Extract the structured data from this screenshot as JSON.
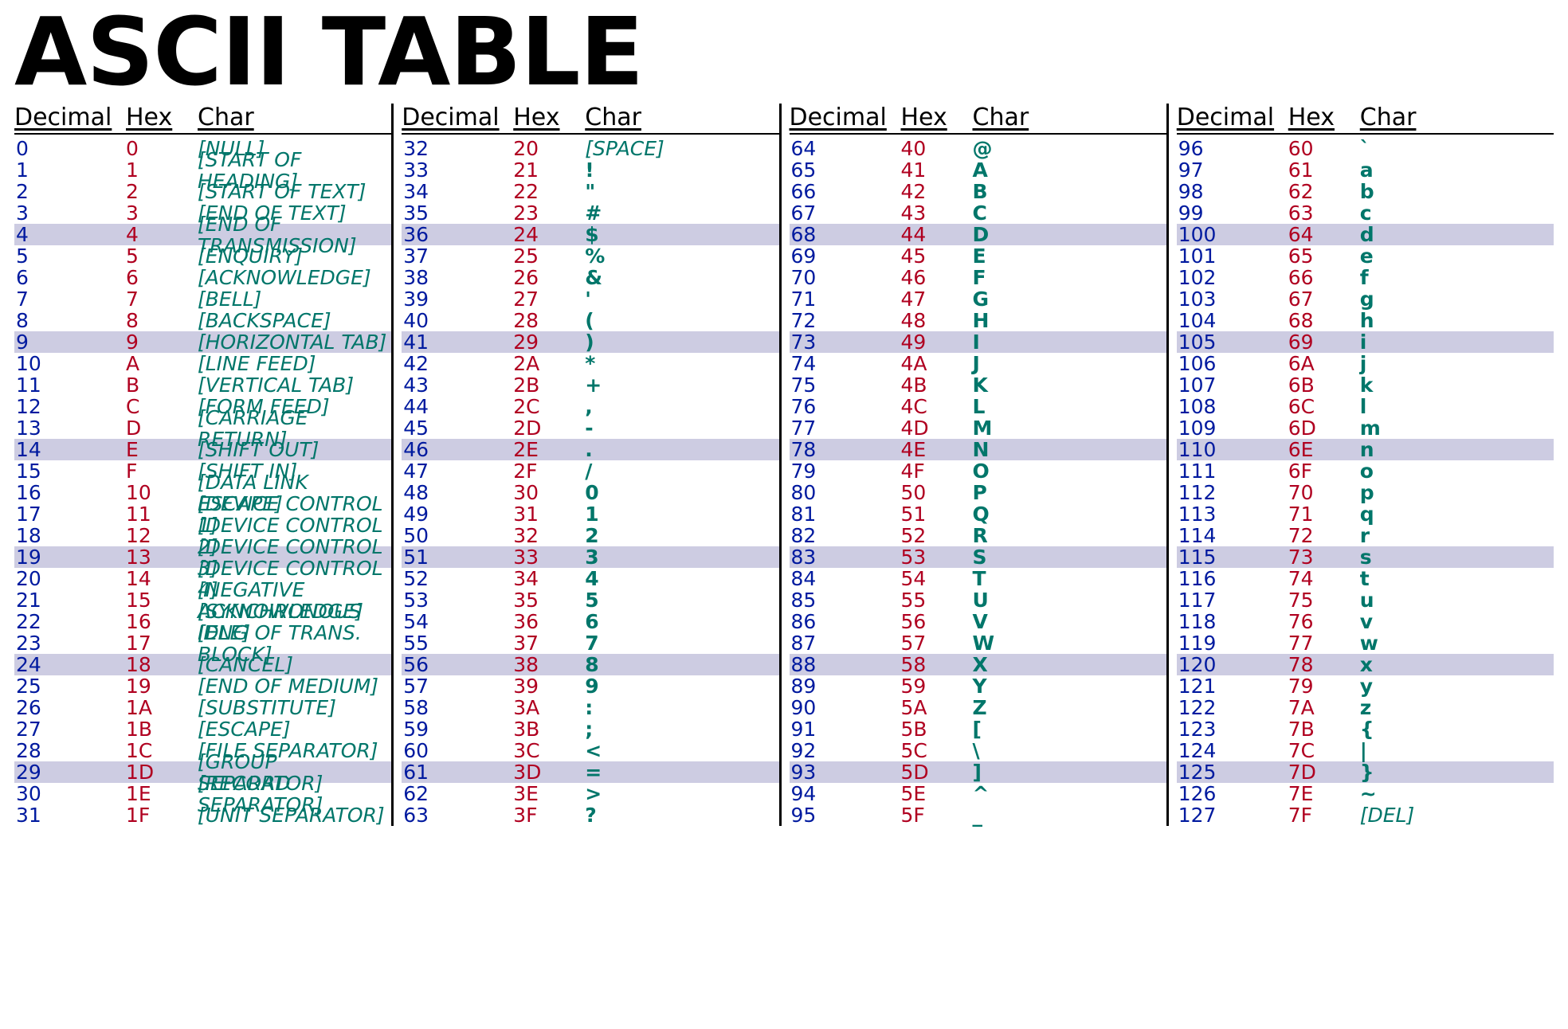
{
  "title": "ASCII TABLE",
  "headers": {
    "dec": "Decimal",
    "hex": "Hex",
    "char": "Char"
  },
  "stripe_rows": [
    4,
    9,
    14,
    19,
    24,
    29
  ],
  "columns": [
    [
      {
        "dec": "0",
        "hex": "0",
        "char": "[NULL]",
        "desc": true
      },
      {
        "dec": "1",
        "hex": "1",
        "char": "[START OF HEADING]",
        "desc": true
      },
      {
        "dec": "2",
        "hex": "2",
        "char": "[START OF TEXT]",
        "desc": true
      },
      {
        "dec": "3",
        "hex": "3",
        "char": "[END OF TEXT]",
        "desc": true
      },
      {
        "dec": "4",
        "hex": "4",
        "char": "[END OF TRANSMISSION]",
        "desc": true
      },
      {
        "dec": "5",
        "hex": "5",
        "char": "[ENQUIRY]",
        "desc": true
      },
      {
        "dec": "6",
        "hex": "6",
        "char": "[ACKNOWLEDGE]",
        "desc": true
      },
      {
        "dec": "7",
        "hex": "7",
        "char": "[BELL]",
        "desc": true
      },
      {
        "dec": "8",
        "hex": "8",
        "char": "[BACKSPACE]",
        "desc": true
      },
      {
        "dec": "9",
        "hex": "9",
        "char": "[HORIZONTAL TAB]",
        "desc": true
      },
      {
        "dec": "10",
        "hex": "A",
        "char": "[LINE FEED]",
        "desc": true
      },
      {
        "dec": "11",
        "hex": "B",
        "char": "[VERTICAL TAB]",
        "desc": true
      },
      {
        "dec": "12",
        "hex": "C",
        "char": "[FORM FEED]",
        "desc": true
      },
      {
        "dec": "13",
        "hex": "D",
        "char": "[CARRIAGE RETURN]",
        "desc": true
      },
      {
        "dec": "14",
        "hex": "E",
        "char": "[SHIFT OUT]",
        "desc": true
      },
      {
        "dec": "15",
        "hex": "F",
        "char": "[SHIFT IN]",
        "desc": true
      },
      {
        "dec": "16",
        "hex": "10",
        "char": "[DATA LINK ESCAPE]",
        "desc": true
      },
      {
        "dec": "17",
        "hex": "11",
        "char": "[DEVICE CONTROL 1]",
        "desc": true
      },
      {
        "dec": "18",
        "hex": "12",
        "char": "[DEVICE CONTROL 2]",
        "desc": true
      },
      {
        "dec": "19",
        "hex": "13",
        "char": "[DEVICE CONTROL 3]",
        "desc": true
      },
      {
        "dec": "20",
        "hex": "14",
        "char": "[DEVICE CONTROL 4]",
        "desc": true
      },
      {
        "dec": "21",
        "hex": "15",
        "char": "[NEGATIVE ACKNOWLEDGE]",
        "desc": true
      },
      {
        "dec": "22",
        "hex": "16",
        "char": "[SYNCHRONOUS IDLE]",
        "desc": true
      },
      {
        "dec": "23",
        "hex": "17",
        "char": "[ENG OF TRANS. BLOCK]",
        "desc": true
      },
      {
        "dec": "24",
        "hex": "18",
        "char": "[CANCEL]",
        "desc": true
      },
      {
        "dec": "25",
        "hex": "19",
        "char": "[END OF MEDIUM]",
        "desc": true
      },
      {
        "dec": "26",
        "hex": "1A",
        "char": "[SUBSTITUTE]",
        "desc": true
      },
      {
        "dec": "27",
        "hex": "1B",
        "char": "[ESCAPE]",
        "desc": true
      },
      {
        "dec": "28",
        "hex": "1C",
        "char": "[FILE SEPARATOR]",
        "desc": true
      },
      {
        "dec": "29",
        "hex": "1D",
        "char": "[GROUP SEPARATOR]",
        "desc": true
      },
      {
        "dec": "30",
        "hex": "1E",
        "char": "[RECORD SEPARATOR]",
        "desc": true
      },
      {
        "dec": "31",
        "hex": "1F",
        "char": "[UNIT SEPARATOR]",
        "desc": true
      }
    ],
    [
      {
        "dec": "32",
        "hex": "20",
        "char": "[SPACE]",
        "desc": true
      },
      {
        "dec": "33",
        "hex": "21",
        "char": "!"
      },
      {
        "dec": "34",
        "hex": "22",
        "char": "\""
      },
      {
        "dec": "35",
        "hex": "23",
        "char": "#"
      },
      {
        "dec": "36",
        "hex": "24",
        "char": "$"
      },
      {
        "dec": "37",
        "hex": "25",
        "char": "%"
      },
      {
        "dec": "38",
        "hex": "26",
        "char": "&"
      },
      {
        "dec": "39",
        "hex": "27",
        "char": "'"
      },
      {
        "dec": "40",
        "hex": "28",
        "char": "("
      },
      {
        "dec": "41",
        "hex": "29",
        "char": ")"
      },
      {
        "dec": "42",
        "hex": "2A",
        "char": "*"
      },
      {
        "dec": "43",
        "hex": "2B",
        "char": "+"
      },
      {
        "dec": "44",
        "hex": "2C",
        "char": ","
      },
      {
        "dec": "45",
        "hex": "2D",
        "char": "-"
      },
      {
        "dec": "46",
        "hex": "2E",
        "char": "."
      },
      {
        "dec": "47",
        "hex": "2F",
        "char": "/"
      },
      {
        "dec": "48",
        "hex": "30",
        "char": "0"
      },
      {
        "dec": "49",
        "hex": "31",
        "char": "1"
      },
      {
        "dec": "50",
        "hex": "32",
        "char": "2"
      },
      {
        "dec": "51",
        "hex": "33",
        "char": "3"
      },
      {
        "dec": "52",
        "hex": "34",
        "char": "4"
      },
      {
        "dec": "53",
        "hex": "35",
        "char": "5"
      },
      {
        "dec": "54",
        "hex": "36",
        "char": "6"
      },
      {
        "dec": "55",
        "hex": "37",
        "char": "7"
      },
      {
        "dec": "56",
        "hex": "38",
        "char": "8"
      },
      {
        "dec": "57",
        "hex": "39",
        "char": "9"
      },
      {
        "dec": "58",
        "hex": "3A",
        "char": ":"
      },
      {
        "dec": "59",
        "hex": "3B",
        "char": ";"
      },
      {
        "dec": "60",
        "hex": "3C",
        "char": "<"
      },
      {
        "dec": "61",
        "hex": "3D",
        "char": "="
      },
      {
        "dec": "62",
        "hex": "3E",
        "char": ">"
      },
      {
        "dec": "63",
        "hex": "3F",
        "char": "?"
      }
    ],
    [
      {
        "dec": "64",
        "hex": "40",
        "char": "@"
      },
      {
        "dec": "65",
        "hex": "41",
        "char": "A"
      },
      {
        "dec": "66",
        "hex": "42",
        "char": "B"
      },
      {
        "dec": "67",
        "hex": "43",
        "char": "C"
      },
      {
        "dec": "68",
        "hex": "44",
        "char": "D"
      },
      {
        "dec": "69",
        "hex": "45",
        "char": "E"
      },
      {
        "dec": "70",
        "hex": "46",
        "char": "F"
      },
      {
        "dec": "71",
        "hex": "47",
        "char": "G"
      },
      {
        "dec": "72",
        "hex": "48",
        "char": "H"
      },
      {
        "dec": "73",
        "hex": "49",
        "char": "I"
      },
      {
        "dec": "74",
        "hex": "4A",
        "char": "J"
      },
      {
        "dec": "75",
        "hex": "4B",
        "char": "K"
      },
      {
        "dec": "76",
        "hex": "4C",
        "char": "L"
      },
      {
        "dec": "77",
        "hex": "4D",
        "char": "M"
      },
      {
        "dec": "78",
        "hex": "4E",
        "char": "N"
      },
      {
        "dec": "79",
        "hex": "4F",
        "char": "O"
      },
      {
        "dec": "80",
        "hex": "50",
        "char": "P"
      },
      {
        "dec": "81",
        "hex": "51",
        "char": "Q"
      },
      {
        "dec": "82",
        "hex": "52",
        "char": "R"
      },
      {
        "dec": "83",
        "hex": "53",
        "char": "S"
      },
      {
        "dec": "84",
        "hex": "54",
        "char": "T"
      },
      {
        "dec": "85",
        "hex": "55",
        "char": "U"
      },
      {
        "dec": "86",
        "hex": "56",
        "char": "V"
      },
      {
        "dec": "87",
        "hex": "57",
        "char": "W"
      },
      {
        "dec": "88",
        "hex": "58",
        "char": "X"
      },
      {
        "dec": "89",
        "hex": "59",
        "char": "Y"
      },
      {
        "dec": "90",
        "hex": "5A",
        "char": "Z"
      },
      {
        "dec": "91",
        "hex": "5B",
        "char": "["
      },
      {
        "dec": "92",
        "hex": "5C",
        "char": "\\"
      },
      {
        "dec": "93",
        "hex": "5D",
        "char": "]"
      },
      {
        "dec": "94",
        "hex": "5E",
        "char": "^"
      },
      {
        "dec": "95",
        "hex": "5F",
        "char": "_"
      }
    ],
    [
      {
        "dec": "96",
        "hex": "60",
        "char": "`"
      },
      {
        "dec": "97",
        "hex": "61",
        "char": "a"
      },
      {
        "dec": "98",
        "hex": "62",
        "char": "b"
      },
      {
        "dec": "99",
        "hex": "63",
        "char": "c"
      },
      {
        "dec": "100",
        "hex": "64",
        "char": "d"
      },
      {
        "dec": "101",
        "hex": "65",
        "char": "e"
      },
      {
        "dec": "102",
        "hex": "66",
        "char": "f"
      },
      {
        "dec": "103",
        "hex": "67",
        "char": "g"
      },
      {
        "dec": "104",
        "hex": "68",
        "char": "h"
      },
      {
        "dec": "105",
        "hex": "69",
        "char": "i"
      },
      {
        "dec": "106",
        "hex": "6A",
        "char": "j"
      },
      {
        "dec": "107",
        "hex": "6B",
        "char": "k"
      },
      {
        "dec": "108",
        "hex": "6C",
        "char": "l"
      },
      {
        "dec": "109",
        "hex": "6D",
        "char": "m"
      },
      {
        "dec": "110",
        "hex": "6E",
        "char": "n"
      },
      {
        "dec": "111",
        "hex": "6F",
        "char": "o"
      },
      {
        "dec": "112",
        "hex": "70",
        "char": "p"
      },
      {
        "dec": "113",
        "hex": "71",
        "char": "q"
      },
      {
        "dec": "114",
        "hex": "72",
        "char": "r"
      },
      {
        "dec": "115",
        "hex": "73",
        "char": "s"
      },
      {
        "dec": "116",
        "hex": "74",
        "char": "t"
      },
      {
        "dec": "117",
        "hex": "75",
        "char": "u"
      },
      {
        "dec": "118",
        "hex": "76",
        "char": "v"
      },
      {
        "dec": "119",
        "hex": "77",
        "char": "w"
      },
      {
        "dec": "120",
        "hex": "78",
        "char": "x"
      },
      {
        "dec": "121",
        "hex": "79",
        "char": "y"
      },
      {
        "dec": "122",
        "hex": "7A",
        "char": "z"
      },
      {
        "dec": "123",
        "hex": "7B",
        "char": "{"
      },
      {
        "dec": "124",
        "hex": "7C",
        "char": "|"
      },
      {
        "dec": "125",
        "hex": "7D",
        "char": "}"
      },
      {
        "dec": "126",
        "hex": "7E",
        "char": "~"
      },
      {
        "dec": "127",
        "hex": "7F",
        "char": "[DEL]",
        "desc": true
      }
    ]
  ]
}
